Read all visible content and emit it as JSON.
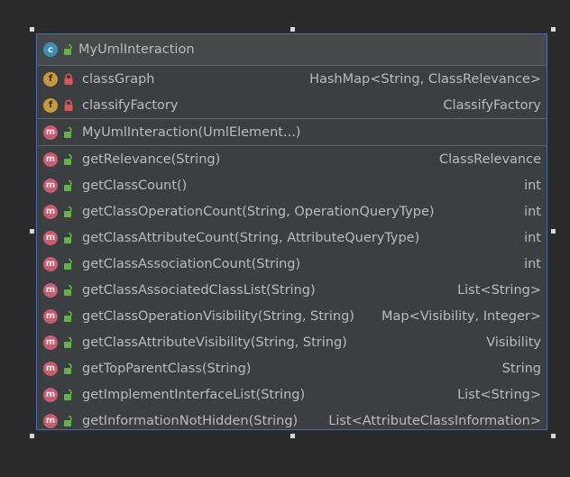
{
  "class_name": "MyUmlInteraction",
  "fields": [
    {
      "name": "classGraph",
      "type": "HashMap<String, ClassRelevance>",
      "visibility": "private"
    },
    {
      "name": "classifyFactory",
      "type": "ClassifyFactory",
      "visibility": "private"
    }
  ],
  "constructors": [
    {
      "name": "MyUmlInteraction(UmlElement...)",
      "type": "",
      "visibility": "public"
    }
  ],
  "methods": [
    {
      "name": "getRelevance(String)",
      "type": "ClassRelevance",
      "visibility": "public"
    },
    {
      "name": "getClassCount()",
      "type": "int",
      "visibility": "public"
    },
    {
      "name": "getClassOperationCount(String, OperationQueryType)",
      "type": "int",
      "visibility": "public"
    },
    {
      "name": "getClassAttributeCount(String, AttributeQueryType)",
      "type": "int",
      "visibility": "public"
    },
    {
      "name": "getClassAssociationCount(String)",
      "type": "int",
      "visibility": "public"
    },
    {
      "name": "getClassAssociatedClassList(String)",
      "type": "List<String>",
      "visibility": "public"
    },
    {
      "name": "getClassOperationVisibility(String, String)",
      "type": "Map<Visibility, Integer>",
      "visibility": "public"
    },
    {
      "name": "getClassAttributeVisibility(String, String)",
      "type": "Visibility",
      "visibility": "public"
    },
    {
      "name": "getTopParentClass(String)",
      "type": "String",
      "visibility": "public"
    },
    {
      "name": "getImplementInterfaceList(String)",
      "type": "List<String>",
      "visibility": "public"
    },
    {
      "name": "getInformationNotHidden(String)",
      "type": "List<AttributeClassInformation>",
      "visibility": "public"
    }
  ],
  "badges": {
    "class": "c",
    "field": "f",
    "method": "m"
  },
  "colors": {
    "background": "#2b2b2b",
    "panel": "#3c3f41",
    "selection_border": "#4a6ea9",
    "class_badge": "#3d8fb6",
    "field_badge": "#c79b3a",
    "method_badge": "#c75e70",
    "public_lock": "#62b543",
    "private_lock": "#e05555"
  },
  "icons": {
    "public": "unlocked-padlock-icon",
    "private": "locked-padlock-icon"
  }
}
